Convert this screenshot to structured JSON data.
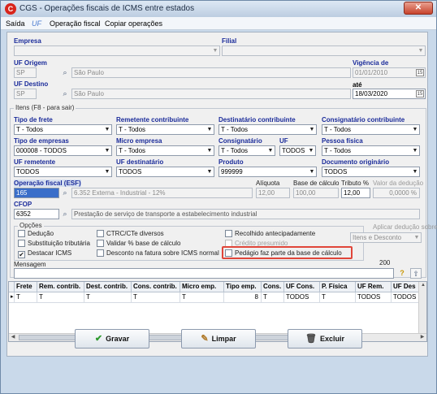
{
  "window": {
    "title": "CGS - Operações fiscais de ICMS entre estados",
    "close": "✕"
  },
  "menu": {
    "items": [
      "Saída",
      "UF",
      "Operação fiscal",
      "Copiar operações"
    ]
  },
  "empresa": {
    "label": "Empresa",
    "value": ""
  },
  "filial": {
    "label": "Filial",
    "value": ""
  },
  "uf_origem": {
    "label": "UF Origem",
    "code": "SP",
    "name": "São Paulo"
  },
  "uf_destino": {
    "label": "UF Destino",
    "code": "SP",
    "name": "São Paulo"
  },
  "vigencia": {
    "label": "Vigência de",
    "de": "01/01/2010",
    "ate_label": "até",
    "ate": "18/03/2020"
  },
  "itens": {
    "group_title": "Itens (F8 - para sair)",
    "tipo_frete": {
      "label": "Tipo de frete",
      "value": "T - Todos"
    },
    "remetente_contribuinte": {
      "label": "Remetente contribuinte",
      "value": "T - Todos"
    },
    "destinatario_contribuinte": {
      "label": "Destinatário contribuinte",
      "value": "T - Todos"
    },
    "consignatario_contribuinte": {
      "label": "Consignatário contribuinte",
      "value": "T - Todos"
    },
    "tipo_empresas": {
      "label": "Tipo de empresas",
      "value": "000008 - TODOS"
    },
    "micro_empresa": {
      "label": "Micro empresa",
      "value": "T - Todos"
    },
    "consignatario": {
      "label": "Consignatário",
      "value": "T - Todos"
    },
    "uf": {
      "label": "UF",
      "value": "TODOS"
    },
    "pessoa_fisica": {
      "label": "Pessoa física",
      "value": "T - Todos"
    },
    "uf_remetente": {
      "label": "UF remetente",
      "value": "TODOS"
    },
    "uf_destinatario": {
      "label": "UF destinatário",
      "value": "TODOS"
    },
    "produto": {
      "label": "Produto",
      "value": "999999"
    },
    "documento_originario": {
      "label": "Documento originário",
      "value": "TODOS"
    },
    "operacao_fiscal": {
      "label": "Operação fiscal (ESF)",
      "code": "165",
      "desc": "6.352 Externa - Industrial - 12%"
    },
    "aliquota": {
      "label": "Alíquota",
      "value": "12,00"
    },
    "base_calculo": {
      "label": "Base de cálculo",
      "value": "100,00"
    },
    "tributo": {
      "label": "Tributo %",
      "value": "12,00"
    },
    "valor_deducao": {
      "label": "Valor da dedução",
      "value": "0,0000 %"
    },
    "cfop": {
      "label": "CFOP",
      "code": "6352",
      "desc": "Prestação de serviço de transporte a estabelecimento industrial"
    }
  },
  "opcoes": {
    "title": "Opções",
    "deducao": "Dedução",
    "substituicao": "Substituição tributária",
    "destacar_icms": "Destacar ICMS",
    "ctrc": "CTRC/CTe diversos",
    "validar_base": "Validar % base de cálculo",
    "desconto_fatura": "Desconto na fatura sobre ICMS normal",
    "recolhido": "Recolhido antecipadamente",
    "credito_presumido": "Crédito presumido",
    "pedagio": "Pedágio faz parte da base de cálculo",
    "aplicar_deducao": "Aplicar dedução sobre",
    "aplicar_value": "Itens e Desconto"
  },
  "mensagem": {
    "label": "Mensagem",
    "counter": "200",
    "help": "?"
  },
  "table": {
    "columns": [
      "Frete",
      "Rem. contrib.",
      "Dest. contrib.",
      "Cons. contrib.",
      "Micro emp.",
      "Tipo emp.",
      "Cons.",
      "UF Cons.",
      "P. Física",
      "UF Rem.",
      "UF Des"
    ],
    "rows": [
      [
        "T",
        "T",
        "T",
        "T",
        "T",
        "8",
        "T",
        "TODOS",
        "T",
        "TODOS",
        "TODOS"
      ]
    ]
  },
  "buttons": {
    "gravar": "Gravar",
    "limpar": "Limpar",
    "excluir": "Excluir"
  },
  "colors": {
    "accent": "#1a2b9a",
    "highlight": "#e0463a",
    "selection": "#3a6ec9"
  }
}
